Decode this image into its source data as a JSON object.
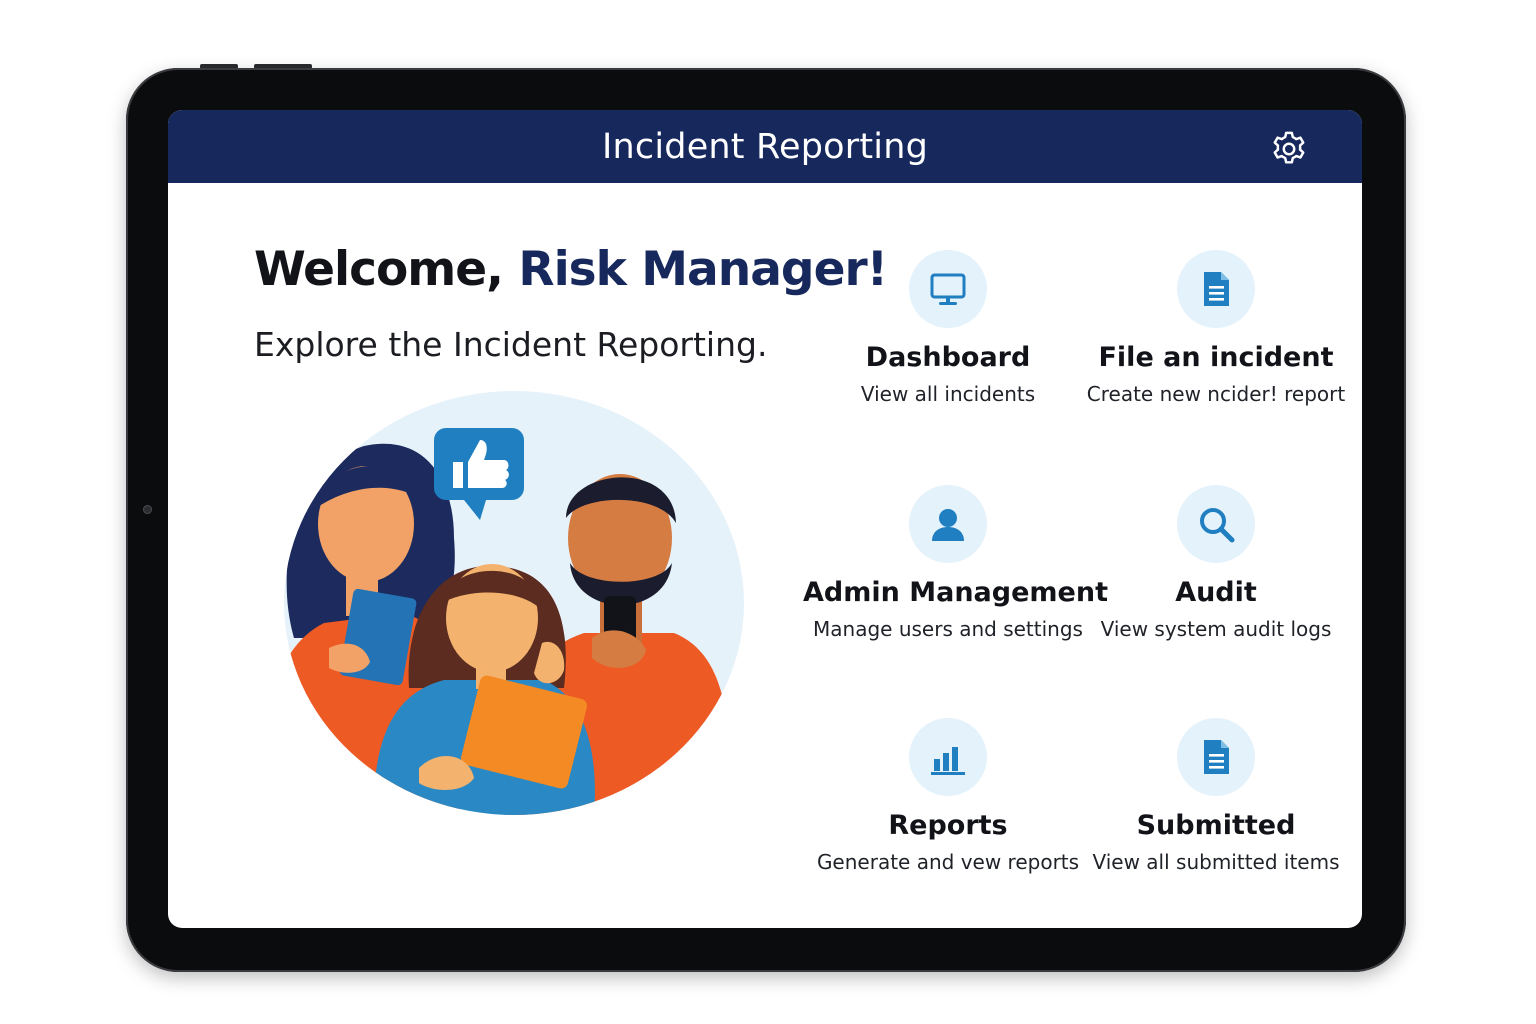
{
  "app": {
    "title": "Incident Reporting"
  },
  "header": {
    "settings_icon": "gear-icon"
  },
  "welcome": {
    "greeting": "Welcome, ",
    "role": "Risk Manager!",
    "subtitle": "Explore the Incident Reporting."
  },
  "colors": {
    "header_bg": "#16285c",
    "accent_blue": "#1f7fc0",
    "badge_bg": "#e4f2fb",
    "orange": "#ee5a24"
  },
  "tiles": [
    {
      "icon": "monitor-icon",
      "title": "Dashboard",
      "description": "View all incidents"
    },
    {
      "icon": "document-icon",
      "title": "File an incident",
      "description": "Create new ncider! report"
    },
    {
      "icon": "user-icon",
      "title": "Admin Management",
      "description": "Manage users and settings"
    },
    {
      "icon": "search-icon",
      "title": "Audit",
      "description": "View system audit logs"
    },
    {
      "icon": "bar-chart-icon",
      "title": "Reports",
      "description": "Generate and vew reports"
    },
    {
      "icon": "document-icon",
      "title": "Submitted",
      "description": "View all submitted items"
    }
  ]
}
